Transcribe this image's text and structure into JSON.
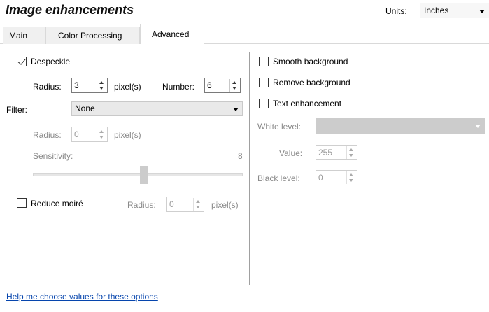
{
  "header": {
    "title": "Image enhancements",
    "units_label": "Units:",
    "units_value": "Inches"
  },
  "tabs": [
    {
      "label": "Main",
      "active": false
    },
    {
      "label": "Color Processing",
      "active": false
    },
    {
      "label": "Advanced",
      "active": true
    }
  ],
  "left": {
    "despeckle": {
      "label": "Despeckle",
      "checked": true
    },
    "radius_label": "Radius:",
    "radius_value": "3",
    "radius_unit": "pixel(s)",
    "number_label": "Number:",
    "number_value": "6",
    "filter_label": "Filter:",
    "filter_value": "None",
    "filter_radius_label": "Radius:",
    "filter_radius_value": "0",
    "filter_radius_unit": "pixel(s)",
    "sensitivity_label": "Sensitivity:",
    "sensitivity_value": "8",
    "sensitivity_level": 0.53,
    "reduce_moire": {
      "label": "Reduce moiré",
      "checked": false
    },
    "moire_radius_label": "Radius:",
    "moire_radius_value": "0",
    "moire_radius_unit": "pixel(s)"
  },
  "right": {
    "smooth_background": {
      "label": "Smooth background",
      "checked": false
    },
    "remove_background": {
      "label": "Remove background",
      "checked": false
    },
    "text_enhancement": {
      "label": "Text enhancement",
      "checked": false
    },
    "white_level_label": "White level:",
    "white_level_value": "",
    "value_label": "Value:",
    "value_value": "255",
    "black_level_label": "Black level:",
    "black_level_value": "0"
  },
  "footer": {
    "help_link": "Help me choose values for these options"
  },
  "colors": {
    "link": "#0645ad",
    "disabled_text": "#8a8a8a"
  }
}
